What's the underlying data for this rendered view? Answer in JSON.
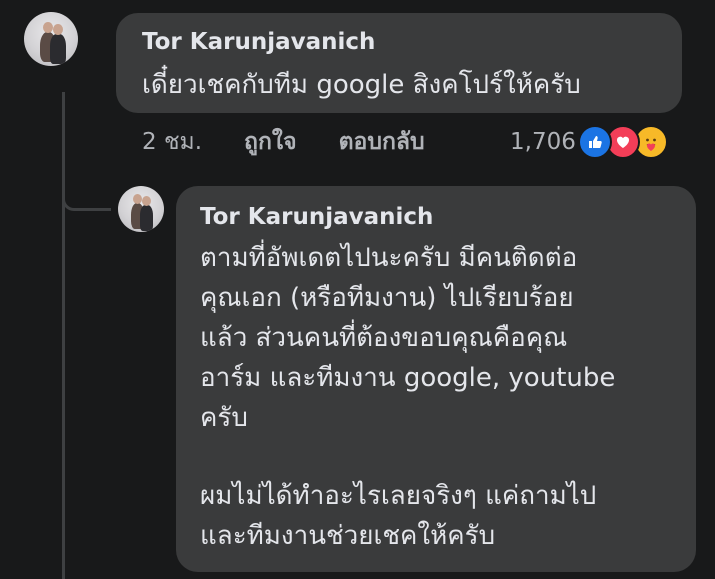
{
  "comment": {
    "author": "Tor Karunjavanich",
    "text": "เดี๋ยวเชคกับทีม google สิงคโปร์ให้ครับ",
    "time": "2 ชม.",
    "like_label": "ถูกใจ",
    "reply_label": "ตอบกลับ",
    "reaction_count": "1,706",
    "reactions": [
      "like-icon",
      "love-icon",
      "care-icon"
    ],
    "colors": {
      "like": "#1b74e4",
      "love": "#f33e58",
      "care": "#f7b928"
    }
  },
  "reply": {
    "author": "Tor Karunjavanich",
    "lines": [
      "ตามที่อัพเดตไปนะครับ มีคนติดต่อ",
      "คุณเอก (หรือทีมงาน) ไปเรียบร้อย",
      "แล้ว ส่วนคนที่ต้องขอบคุณคือคุณ",
      "อาร์ม และทีมงาน google, youtube",
      "ครับ",
      "ผมไม่ได้ทำอะไรเลยจริงๆ แค่ถามไป",
      "และทีมงานช่วยเชคให้ครับ"
    ]
  }
}
